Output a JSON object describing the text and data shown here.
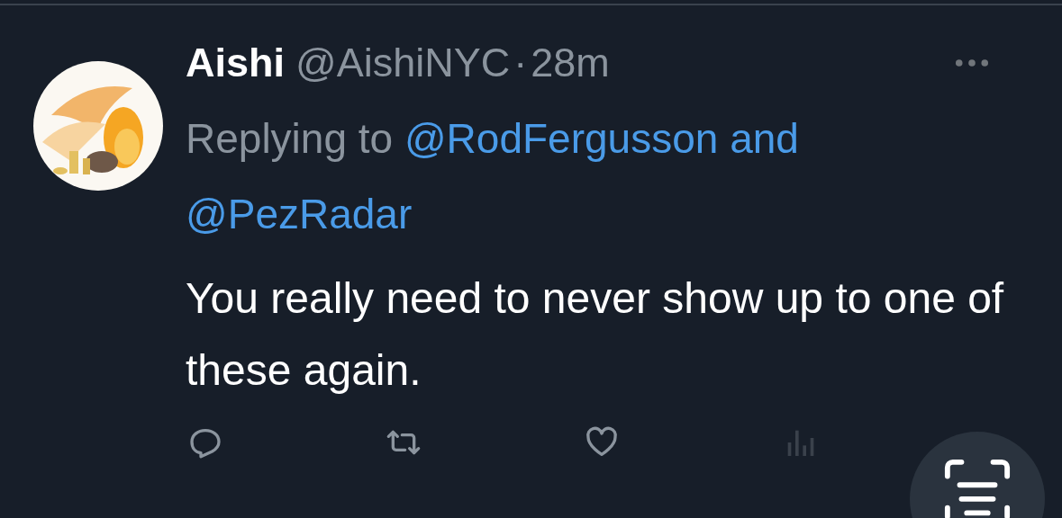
{
  "tweet": {
    "name": "Aishi",
    "handle": "@AishiNYC",
    "separator": "·",
    "time": "28m",
    "reply": {
      "prefix": "Replying to",
      "mentions": [
        "@RodFergusson",
        "@PezRadar"
      ],
      "conjunction": "and"
    },
    "text": "You really need to never show up to one of these again."
  },
  "actions": [
    {
      "kind": "reply"
    },
    {
      "kind": "repost"
    },
    {
      "kind": "like"
    },
    {
      "kind": "views"
    }
  ],
  "fab": {
    "kind": "scan"
  }
}
